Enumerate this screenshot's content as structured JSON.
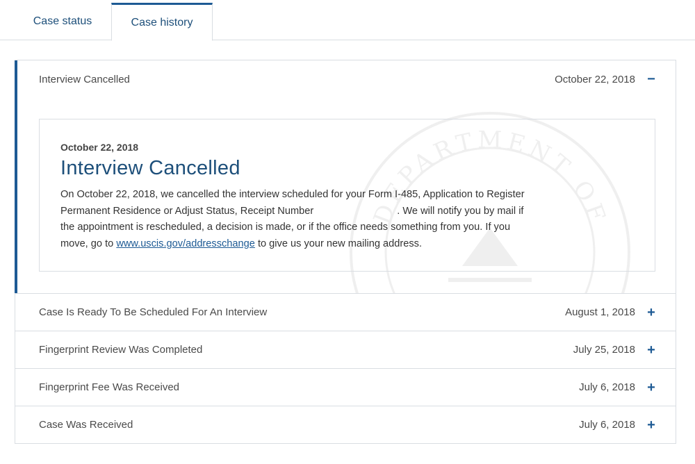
{
  "tabs": [
    {
      "label": "Case status"
    },
    {
      "label": "Case history"
    }
  ],
  "history": {
    "expanded": {
      "title": "Interview Cancelled",
      "date": "October 22, 2018",
      "toggle": "−",
      "detail": {
        "date": "October 22, 2018",
        "heading": "Interview Cancelled",
        "body_part1": "On October 22, 2018, we cancelled the interview scheduled for your Form I-485, Application to Register Permanent Residence or Adjust Status, Receipt Number",
        "body_part2": ". We will notify you by mail if the appointment is rescheduled, a decision is made, or if the office needs something from you. If you move, go to",
        "link_text": "www.uscis.gov/addresschange",
        "body_part3": "to give us your new mailing address."
      },
      "seal_text": "DEPARTMENT OF"
    },
    "items": [
      {
        "title": "Case Is Ready To Be Scheduled For An Interview",
        "date": "August 1, 2018",
        "toggle": "+"
      },
      {
        "title": "Fingerprint Review Was Completed",
        "date": "July 25, 2018",
        "toggle": "+"
      },
      {
        "title": "Fingerprint Fee Was Received",
        "date": "July 6, 2018",
        "toggle": "+"
      },
      {
        "title": "Case Was Received",
        "date": "July 6, 2018",
        "toggle": "+"
      }
    ]
  },
  "colors": {
    "accent": "#1d5a94",
    "heading": "#1d4f7a",
    "border": "#d9dde2",
    "text": "#333333"
  }
}
